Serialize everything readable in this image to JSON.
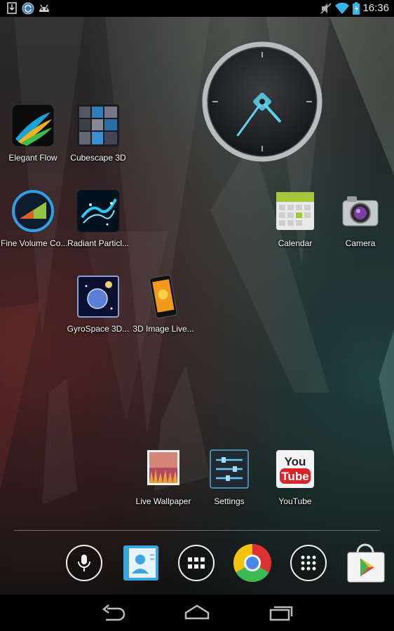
{
  "status_bar": {
    "time": "16:36",
    "left_icons": [
      "download-icon",
      "sync-icon",
      "android-icon"
    ],
    "right_icons": [
      "mute-icon",
      "wifi-icon",
      "battery-icon"
    ]
  },
  "home": {
    "apps": [
      {
        "id": "elegant-flow",
        "label": "Elegant Flow"
      },
      {
        "id": "cubescape-3d",
        "label": "Cubescape 3D"
      },
      {
        "id": "fine-volume",
        "label": "Fine Volume Co..."
      },
      {
        "id": "radiant-particles",
        "label": "Radiant Particl..."
      },
      {
        "id": "calendar",
        "label": "Calendar"
      },
      {
        "id": "camera",
        "label": "Camera"
      },
      {
        "id": "gyrospace-3d",
        "label": "GyroSpace 3D..."
      },
      {
        "id": "3d-image-live",
        "label": "3D Image Live..."
      },
      {
        "id": "live-wallpaper",
        "label": "Live Wallpaper"
      },
      {
        "id": "settings",
        "label": "Settings"
      },
      {
        "id": "youtube",
        "label": "YouTube"
      }
    ],
    "clock_widget": {
      "hour": 4,
      "minute": 36
    }
  },
  "dock": {
    "items": [
      "voice-search",
      "contacts",
      "app-drawer",
      "chrome",
      "apps-grid",
      "play-store"
    ]
  },
  "nav_bar": {
    "buttons": [
      "back",
      "home",
      "recent-apps"
    ]
  },
  "colors": {
    "clock_hand": "#5fd3ee",
    "status_bar_icon": "#33b5e5"
  }
}
